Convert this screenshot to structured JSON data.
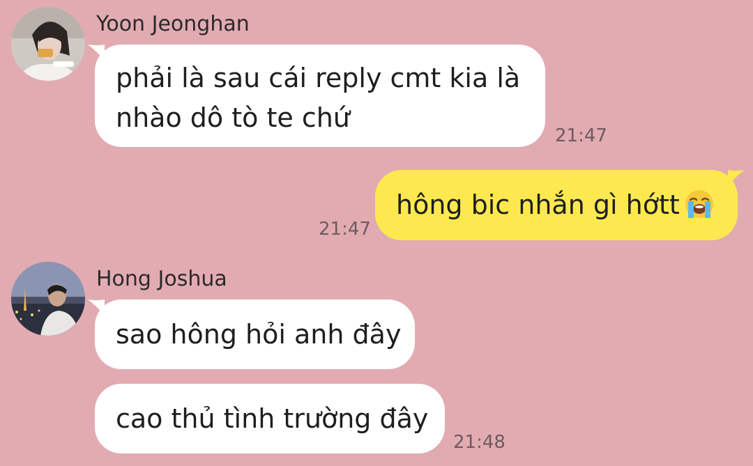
{
  "messages": [
    {
      "sender": "Yoon Jeonghan",
      "lines": [
        "phải là sau cái reply cmt kia là",
        "nhào dô tò te chứ"
      ],
      "time": "21:47"
    },
    {
      "sender": "me",
      "text": "hông bic nhắn gì hớtt",
      "emoji": "loudly-crying-face-emoji",
      "time": "21:47"
    },
    {
      "sender": "Hong Joshua",
      "text_1": "sao hông hỏi anh đây",
      "text_2": "cao thủ tình trường đây",
      "time": "21:48"
    }
  ],
  "colors": {
    "background": "#e2abb2",
    "incoming_bubble": "#ffffff",
    "outgoing_bubble": "#fde94f",
    "timestamp": "#6d5a5e"
  }
}
